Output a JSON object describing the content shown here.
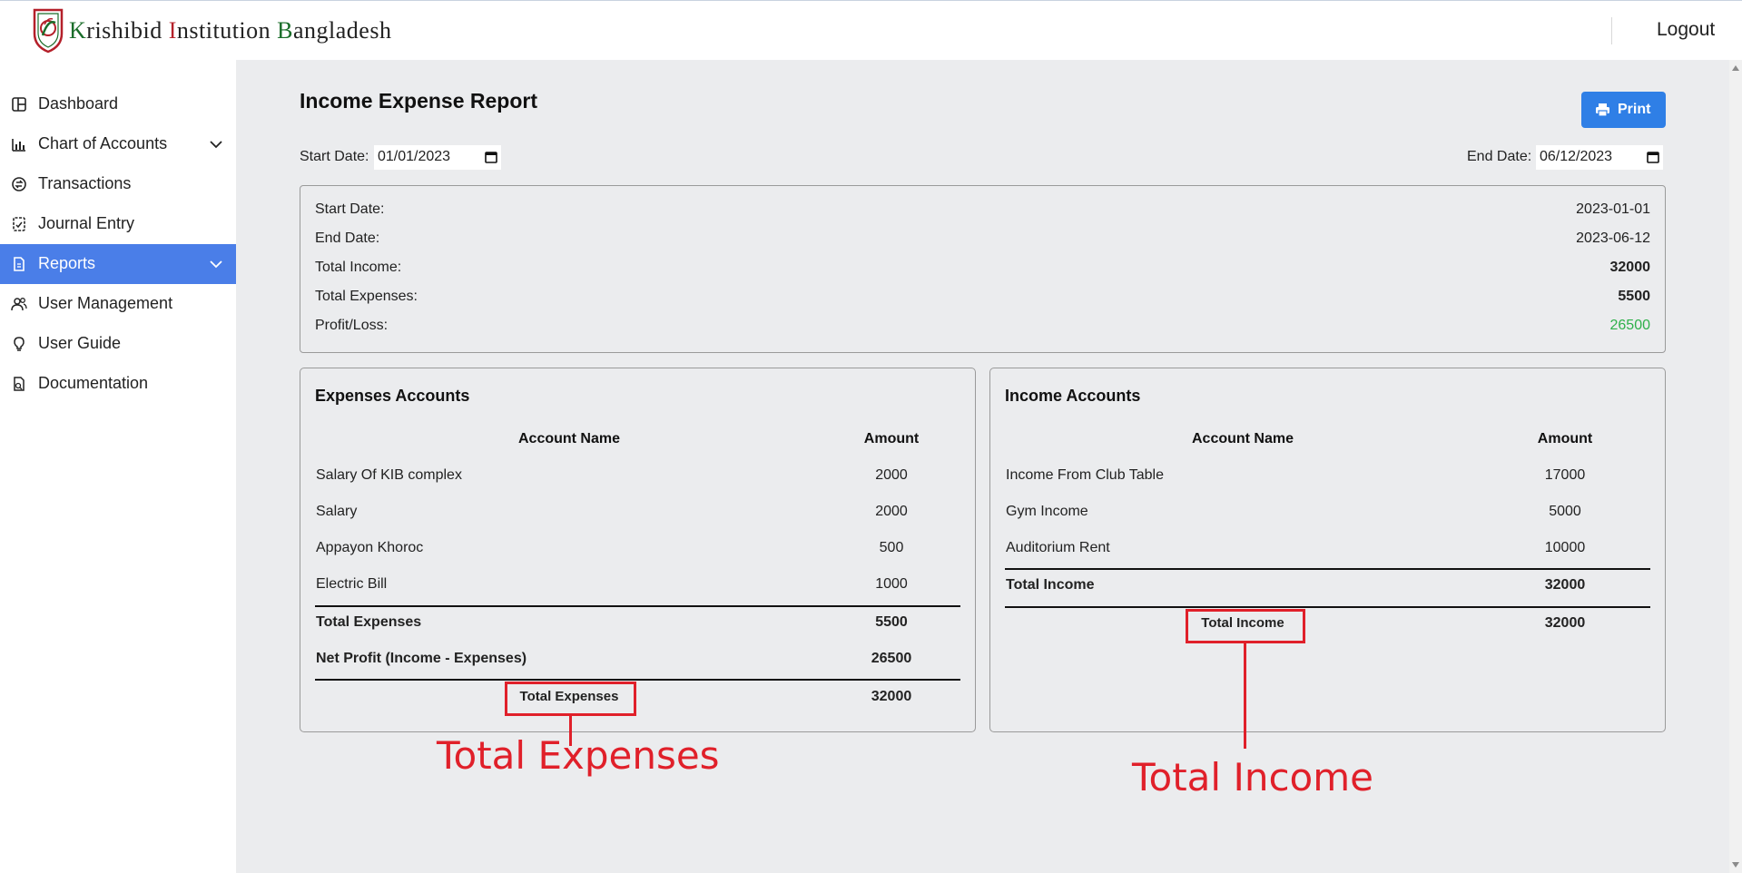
{
  "header": {
    "brand_k": "K",
    "brand_rest1": "rishibid ",
    "brand_i": "I",
    "brand_rest2": "nstitution ",
    "brand_b": "B",
    "brand_rest3": "angladesh",
    "logout_label": "Logout"
  },
  "sidebar": {
    "items": [
      {
        "label": "Dashboard",
        "icon": "dashboard-icon"
      },
      {
        "label": "Chart of Accounts",
        "icon": "chart-icon"
      },
      {
        "label": "Transactions",
        "icon": "transactions-icon"
      },
      {
        "label": "Journal Entry",
        "icon": "journal-icon"
      },
      {
        "label": "Reports",
        "icon": "reports-icon",
        "active": true
      },
      {
        "label": "User Management",
        "icon": "users-icon"
      },
      {
        "label": "User Guide",
        "icon": "lightbulb-icon"
      },
      {
        "label": "Documentation",
        "icon": "documentation-icon"
      }
    ]
  },
  "page": {
    "title": "Income Expense Report",
    "print_label": "Print",
    "start_date_label": "Start Date:",
    "start_date_value": "01/01/2023",
    "end_date_label": "End Date:",
    "end_date_value": "06/12/2023"
  },
  "summary": {
    "start_label": "Start Date:",
    "start_value": "2023-01-01",
    "end_label": "End Date:",
    "end_value": "2023-06-12",
    "income_label": "Total Income:",
    "income_value": "32000",
    "expenses_label": "Total Expenses:",
    "expenses_value": "5500",
    "profit_label": "Profit/Loss:",
    "profit_value": "26500"
  },
  "expenses": {
    "title": "Expenses Accounts",
    "col_name": "Account Name",
    "col_amount": "Amount",
    "rows": [
      {
        "name": "Salary Of KIB complex",
        "amount": "2000"
      },
      {
        "name": "Salary",
        "amount": "2000"
      },
      {
        "name": "Appayon Khoroc",
        "amount": "500"
      },
      {
        "name": "Electric Bill",
        "amount": "1000"
      }
    ],
    "total_label": "Total Expenses",
    "total_value": "5500",
    "net_label": "Net Profit (Income - Expenses)",
    "net_value": "26500",
    "grand_label": "Total Expenses",
    "grand_value": "32000"
  },
  "income": {
    "title": "Income Accounts",
    "col_name": "Account Name",
    "col_amount": "Amount",
    "rows": [
      {
        "name": "Income From Club Table",
        "amount": "17000"
      },
      {
        "name": "Gym Income",
        "amount": "5000"
      },
      {
        "name": "Auditorium Rent",
        "amount": "10000"
      }
    ],
    "total_label": "Total Income",
    "total_value": "32000",
    "grand_label": "Total Income",
    "grand_value": "32000"
  },
  "annotations": {
    "expenses_callout": "Total Expenses",
    "income_callout": "Total Income",
    "color": "#e0202a"
  },
  "colors": {
    "accent": "#4a7ee8",
    "print_button": "#2f7fe6",
    "profit_green": "#2eb04a"
  }
}
